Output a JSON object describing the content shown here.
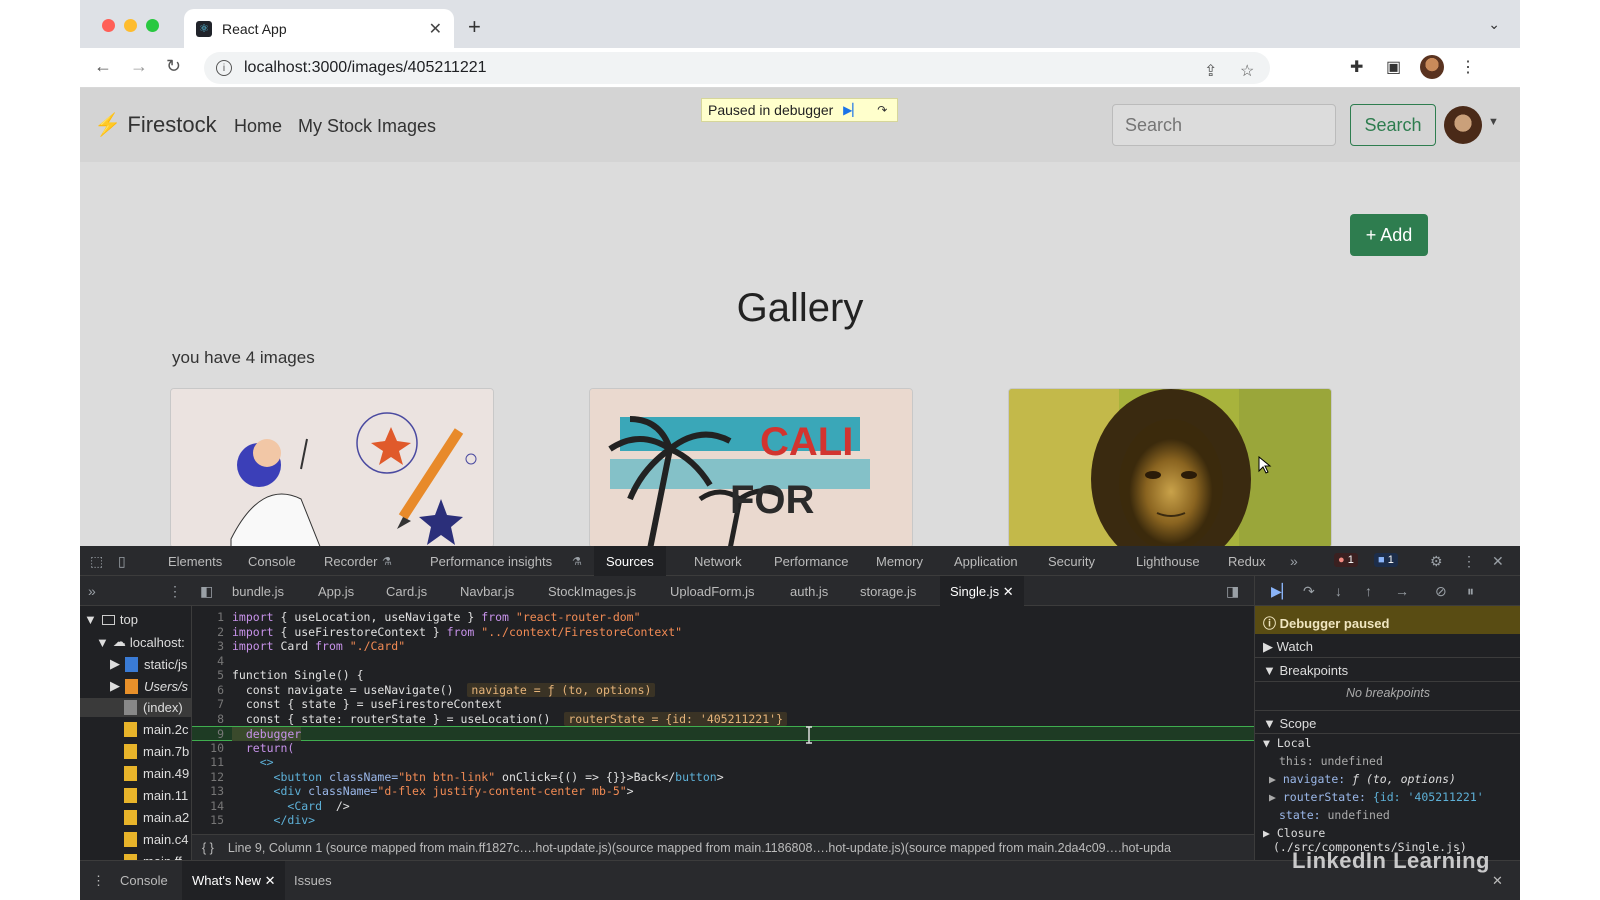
{
  "browser": {
    "tab_title": "React App",
    "new_tab_label": "+",
    "url": "localhost:3000/images/405211221",
    "icons": [
      "back-icon",
      "forward-icon",
      "reload-icon",
      "info-icon",
      "share-icon",
      "star-icon",
      "extensions-icon",
      "sidepanel-icon",
      "avatar",
      "menu-icon"
    ]
  },
  "app": {
    "brand": "Firestock",
    "nav": [
      "Home",
      "My Stock Images"
    ],
    "paused_banner": "Paused in debugger",
    "search_placeholder": "Search",
    "search_button": "Search",
    "add_button": "+ Add",
    "gallery_title": "Gallery",
    "image_count": "you have 4 images",
    "cards": [
      {
        "caption_a": "CALI",
        "caption_b": "FOR"
      }
    ],
    "colors": {
      "brand_green": "#2e7d4f",
      "accent": "#e8a93b"
    }
  },
  "devtools": {
    "tabs": [
      "Elements",
      "Console",
      "Recorder",
      "Performance insights",
      "Sources",
      "Network",
      "Performance",
      "Memory",
      "Application",
      "Security",
      "Lighthouse",
      "Redux"
    ],
    "active_tab": "Sources",
    "error_count": "1",
    "message_count": "1",
    "files": [
      "bundle.js",
      "App.js",
      "Card.js",
      "Navbar.js",
      "StockImages.js",
      "UploadForm.js",
      "auth.js",
      "storage.js",
      "Single.js"
    ],
    "active_file": "Single.js",
    "tree": [
      "top",
      "localhost:",
      "static/js",
      "Users/s",
      "(index)",
      "main.2c",
      "main.7b",
      "main.49",
      "main.11",
      "main.a2",
      "main.c4",
      "main.ff"
    ],
    "code_lines": [
      "1",
      "2",
      "3",
      "4",
      "5",
      "6",
      "7",
      "8",
      "9",
      "10",
      "11",
      "12",
      "13",
      "14",
      "15"
    ],
    "code": {
      "l1_a": "import { useLocation, useNavigate } from ",
      "l1_b": "\"react-router-dom\"",
      "l2_a": "import { useFirestoreContext } from ",
      "l2_b": "\"../context/FirestoreContext\"",
      "l3_a": "import Card from ",
      "l3_b": "\"./Card\"",
      "l5": "function Single() {",
      "l6": "  const navigate = useNavigate()",
      "l6_inline": "navigate = ƒ (to, options)",
      "l7": "  const { state } = useFirestoreContext",
      "l8": "  const { state: routerState } = useLocation()",
      "l8_inline": "routerState = {id: '405211221'}",
      "l9": "  debugger",
      "l10": "  return(",
      "l11": "    <>",
      "l12_a": "<button",
      "l12_b": " className=",
      "l12_c": "\"btn btn-link\"",
      "l12_d": " onClick={() => {}}>Back</",
      "l12_e": "button",
      "l12_f": ">",
      "l13_a": "<div",
      "l13_b": " className=",
      "l13_c": "\"d-flex justify-content-center mb-5\"",
      "l13_d": ">",
      "l14_a": "<Card",
      "l14_b": "  />",
      "l15_a": "</div>"
    },
    "status": "Line 9, Column 1  (source mapped from main.ff1827c….hot-update.js)(source mapped from main.1186808….hot-update.js)(source mapped from main.2da4c09….hot-upda",
    "debugger_paused": "Debugger paused",
    "sections": [
      "Watch",
      "Breakpoints",
      "Scope"
    ],
    "no_breakpoints": "No breakpoints",
    "scope": {
      "local": "Local",
      "this_key": "this:",
      "this_val": "undefined",
      "navigate_key": "navigate:",
      "navigate_val": "ƒ (to, options)",
      "router_key": "routerState:",
      "router_val": "{id: '405211221'",
      "state_key": "state:",
      "state_val": "undefined",
      "closure": "Closure",
      "closure_path": "(./src/components/Single.js)"
    },
    "drawer_tabs": [
      "Console",
      "What's New",
      "Issues"
    ],
    "active_drawer": "What's New",
    "watermark": "LinkedIn Learning"
  }
}
